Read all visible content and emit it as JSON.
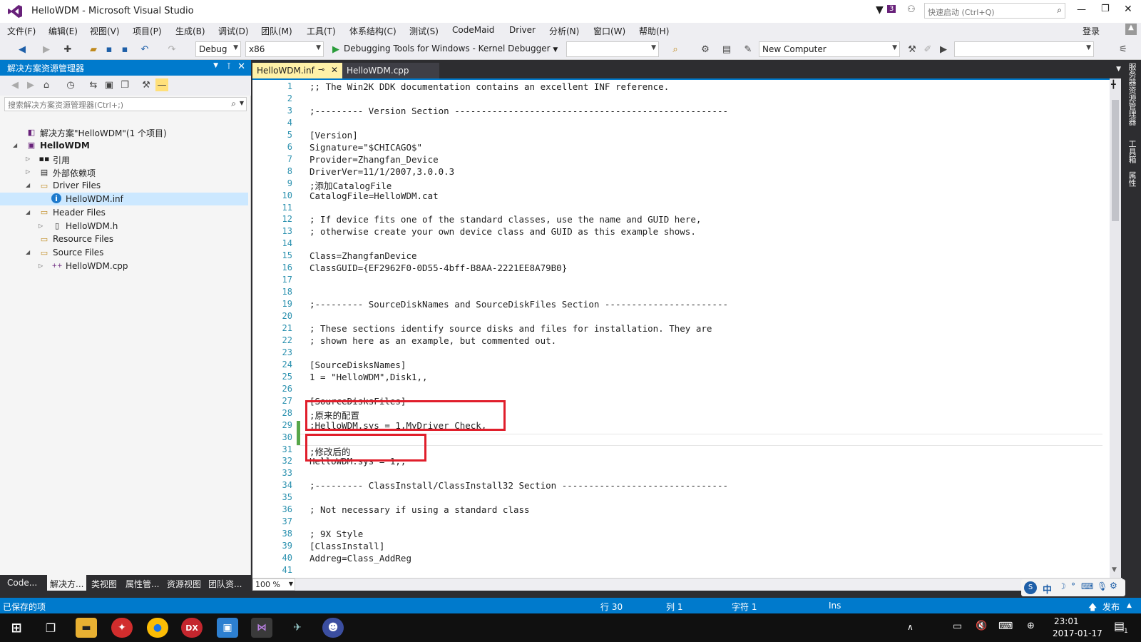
{
  "window": {
    "title": "HelloWDM - Microsoft Visual Studio",
    "notification_count": "3",
    "quick_launch_placeholder": "快速启动 (Ctrl+Q)",
    "login": "登录"
  },
  "menu": [
    "文件(F)",
    "编辑(E)",
    "视图(V)",
    "项目(P)",
    "生成(B)",
    "调试(D)",
    "团队(M)",
    "工具(T)",
    "体系结构(C)",
    "测试(S)",
    "CodeMaid",
    "Driver",
    "分析(N)",
    "窗口(W)",
    "帮助(H)"
  ],
  "toolbar": {
    "config": "Debug",
    "platform": "x86",
    "debugger": "Debugging Tools for Windows - Kernel Debugger",
    "target": "New Computer"
  },
  "solution_explorer": {
    "header": "解决方案资源管理器",
    "search_placeholder": "搜索解决方案资源管理器(Ctrl+;)",
    "tree": [
      {
        "label": "解决方案\"HelloWDM\"(1 个项目)",
        "icon": "solution-icon",
        "glyph": "◧",
        "level": 0,
        "twisty": ""
      },
      {
        "label": "HelloWDM",
        "icon": "project-icon",
        "glyph": "▣",
        "level": 0,
        "twisty": "◢",
        "bold": true
      },
      {
        "label": "引用",
        "icon": "references-icon",
        "glyph": "▪▪",
        "level": 1,
        "twisty": "▷"
      },
      {
        "label": "外部依赖项",
        "icon": "external-deps-icon",
        "glyph": "▤",
        "level": 1,
        "twisty": "▷"
      },
      {
        "label": "Driver Files",
        "icon": "folder-icon",
        "glyph": "▭",
        "level": 1,
        "twisty": "◢"
      },
      {
        "label": "HelloWDM.inf",
        "icon": "info-icon",
        "glyph": "i",
        "level": 2,
        "twisty": "",
        "selected": true
      },
      {
        "label": "Header Files",
        "icon": "folder-icon",
        "glyph": "▭",
        "level": 1,
        "twisty": "◢"
      },
      {
        "label": "HelloWDM.h",
        "icon": "header-file-icon",
        "glyph": "▯",
        "level": 2,
        "twisty": "▷"
      },
      {
        "label": "Resource Files",
        "icon": "folder-icon",
        "glyph": "▭",
        "level": 1,
        "twisty": ""
      },
      {
        "label": "Source Files",
        "icon": "folder-icon",
        "glyph": "▭",
        "level": 1,
        "twisty": "◢"
      },
      {
        "label": "HelloWDM.cpp",
        "icon": "cpp-file-icon",
        "glyph": "++",
        "level": 2,
        "twisty": "▷"
      }
    ],
    "bottom_tabs": [
      "Code...",
      "解决方...",
      "类视图",
      "属性管...",
      "资源视图",
      "团队资..."
    ]
  },
  "editor": {
    "tabs": [
      "HelloWDM.inf",
      "HelloWDM.cpp"
    ],
    "zoom": "100 %",
    "lines": [
      ";; The Win2K DDK documentation contains an excellent INF reference.",
      "",
      ";--------- Version Section ---------------------------------------------------",
      "",
      "[Version]",
      "Signature=\"$CHICAGO$\"",
      "Provider=Zhangfan_Device",
      "DriverVer=11/1/2007,3.0.0.3",
      ";添加CatalogFile",
      "CatalogFile=HelloWDM.cat",
      "",
      "; If device fits one of the standard classes, use the name and GUID here,",
      "; otherwise create your own device class and GUID as this example shows.",
      "",
      "Class=ZhangfanDevice",
      "ClassGUID={EF2962F0-0D55-4bff-B8AA-2221EE8A79B0}",
      "",
      "",
      ";--------- SourceDiskNames and SourceDiskFiles Section -----------------------",
      "",
      "; These sections identify source disks and files for installation. They are",
      "; shown here as an example, but commented out.",
      "",
      "[SourceDisksNames]",
      "1 = \"HelloWDM\",Disk1,,",
      "",
      "[SourceDisksFiles]",
      ";原来的配置",
      ";HelloWDM.sys = 1,MyDriver_Check,",
      "",
      ";修改后的",
      "HelloWDM.sys = 1,,",
      "",
      ";--------- ClassInstall/ClassInstall32 Section -------------------------------",
      "",
      "; Not necessary if using a standard class",
      "",
      "; 9X Style",
      "[ClassInstall]",
      "Addreg=Class_AddReg",
      ""
    ]
  },
  "right_rail": [
    "服务器资源管理器",
    "工具箱",
    "属性"
  ],
  "status": {
    "message": "已保存的项",
    "row": "行 30",
    "col": "列 1",
    "char": "字符 1",
    "mode": "Ins",
    "publish": "发布"
  },
  "taskbar": {
    "time": "23:01",
    "date": "2017-01-17",
    "notify_count": "1"
  },
  "ime": "中"
}
